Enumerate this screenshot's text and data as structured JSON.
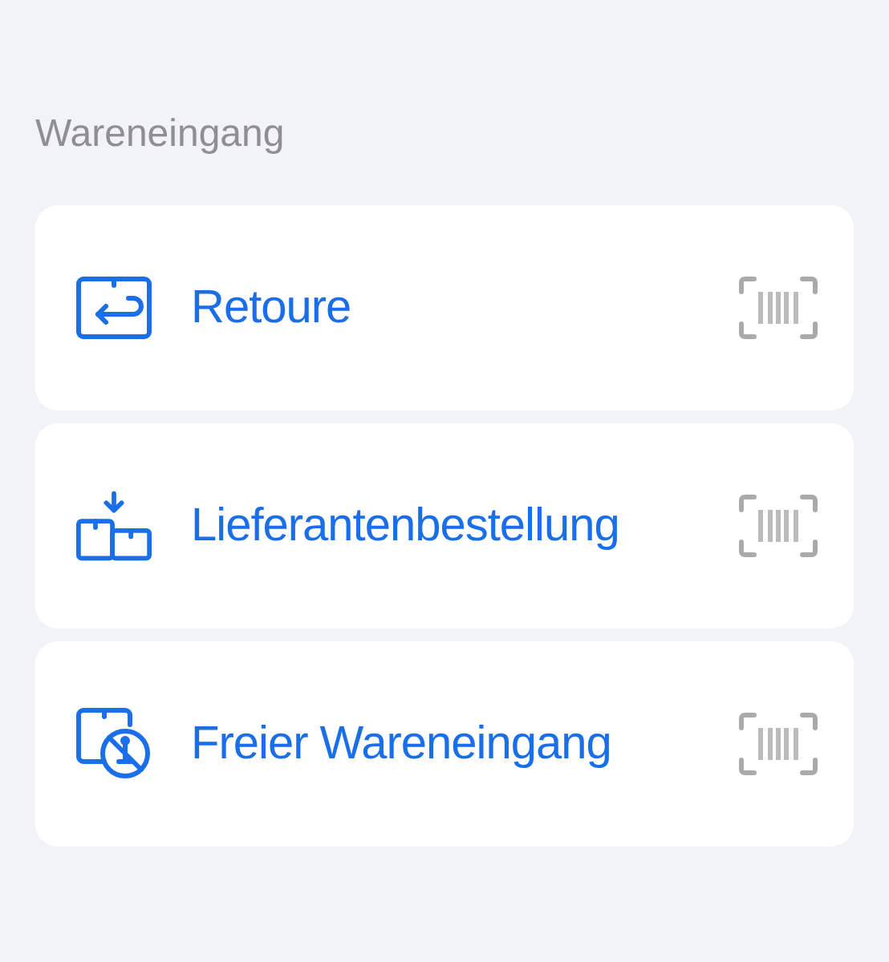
{
  "section": {
    "title": "Wareneingang"
  },
  "items": [
    {
      "label": "Retoure",
      "kind": "return"
    },
    {
      "label": "Lieferantenbestellung",
      "kind": "supplier"
    },
    {
      "label": "Freier Wareneingang",
      "kind": "free"
    }
  ]
}
